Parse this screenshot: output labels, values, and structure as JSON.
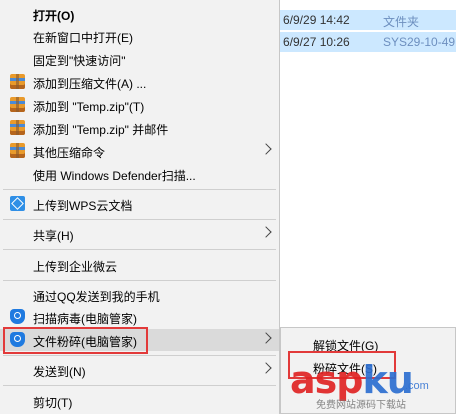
{
  "explorer_rows": [
    {
      "date": "6/9/29 14:42",
      "type": "文件夹"
    },
    {
      "date": "6/9/27 10:26",
      "type": "SYS29-10-49"
    }
  ],
  "context_menu": {
    "items": [
      {
        "label": "打开(O)"
      },
      {
        "label": "在新窗口中打开(E)"
      },
      {
        "label": "固定到\"快速访问\""
      },
      {
        "label": "添加到压缩文件(A) ..."
      },
      {
        "label": "添加到 \"Temp.zip\"(T)"
      },
      {
        "label": "添加到 \"Temp.zip\" 并邮件"
      },
      {
        "label": "其他压缩命令"
      },
      {
        "label": "使用 Windows Defender扫描..."
      },
      {
        "label": "上传到WPS云文档"
      },
      {
        "label": "共享(H)"
      },
      {
        "label": "上传到企业微云"
      },
      {
        "label": "通过QQ发送到我的手机"
      },
      {
        "label": "扫描病毒(电脑管家)"
      },
      {
        "label": "文件粉碎(电脑管家)"
      },
      {
        "label": "发送到(N)"
      },
      {
        "label": "剪切(T)"
      }
    ]
  },
  "submenu": {
    "items": [
      {
        "label": "解锁文件(G)"
      },
      {
        "label": "粉碎文件(S)"
      }
    ]
  },
  "watermark": {
    "brand_red": "asp",
    "brand_blue": "ku",
    "tld": ".com",
    "footer": "免费网站源码下载站"
  },
  "colors": {
    "menu_bg": "#f2f2f2",
    "selection_bg": "#cce8ff",
    "highlight_box": "#e23a3a",
    "hover_bg": "#dadada"
  }
}
